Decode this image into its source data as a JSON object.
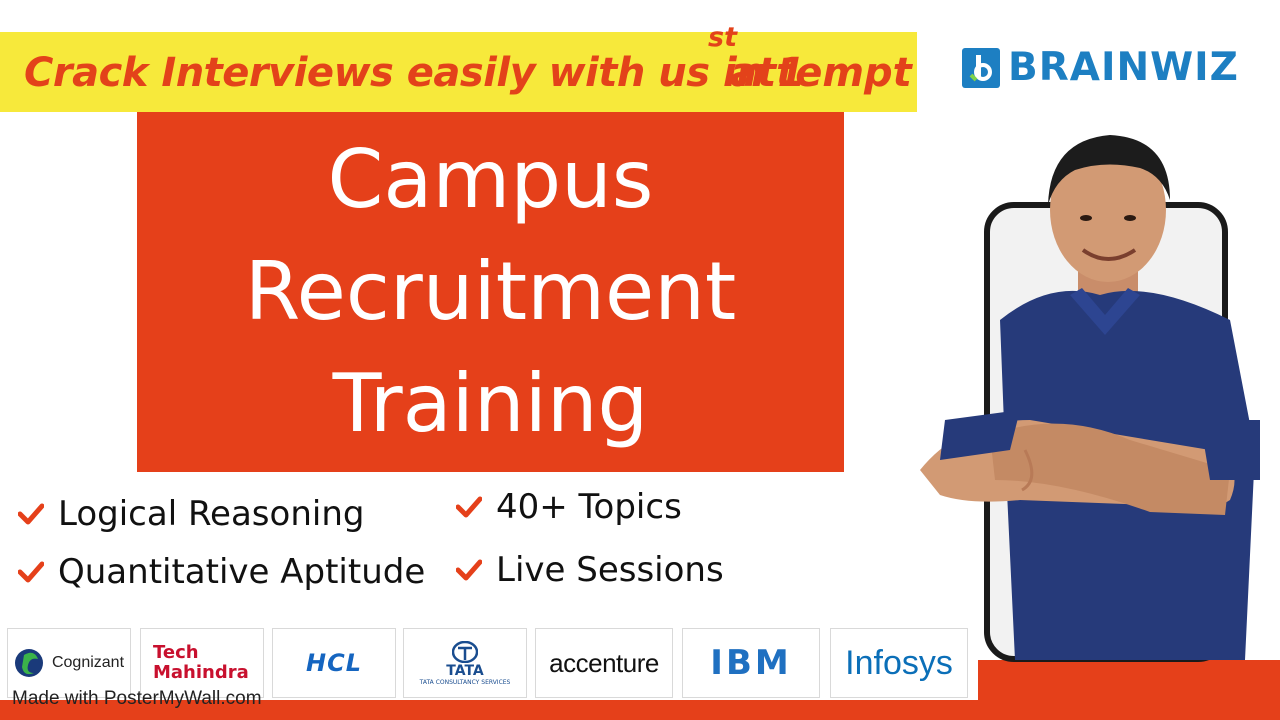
{
  "tagline": {
    "text": "Crack Interviews easily with us in 1",
    "superscript": "st",
    "end": "attempt"
  },
  "brand": {
    "name": "BRAINWIZ",
    "color": "#1d7fc2",
    "icon": "brainwiz-logo-mark"
  },
  "title": {
    "lines": [
      "Campus",
      "Recruitment",
      "Training"
    ],
    "background": "#e5401a"
  },
  "features": {
    "left": [
      "Logical Reasoning",
      "Quantitative Aptitude"
    ],
    "right": [
      "40+ Topics",
      "Live Sessions"
    ],
    "icon": "check-icon"
  },
  "companies": [
    "Cognizant",
    "Tech Mahindra",
    "HCL",
    "TATA",
    "accenture",
    "IBM",
    "Infosys"
  ],
  "company_sub": {
    "tata": "TATA CONSULTANCY SERVICES"
  },
  "watermark": "Made with PosterMyWall.com",
  "colors": {
    "accent": "#e5401a",
    "highlight": "#f7e93b",
    "brand": "#1d7fc2"
  }
}
